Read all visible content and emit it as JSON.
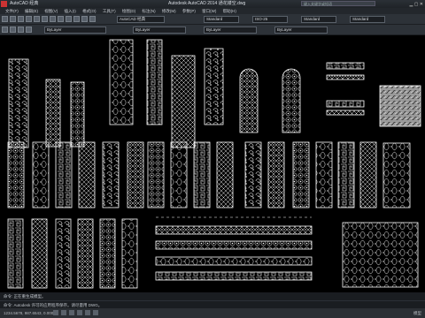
{
  "titlebar": {
    "workspace": "AutoCAD 经典",
    "title": "Autodesk AutoCAD 2014    通花镂空.dwg",
    "search_placeholder": "键入关键字或短语"
  },
  "menubar": [
    "文件(F)",
    "编辑(E)",
    "视图(V)",
    "插入(I)",
    "格式(O)",
    "工具(T)",
    "绘图(D)",
    "标注(N)",
    "修改(M)",
    "参数(P)",
    "窗口(W)",
    "帮助(H)"
  ],
  "toolbar1": {
    "workspace_select": "AutoCAD 经典",
    "text_style": "Standard",
    "dim_style": "ISO-25",
    "table_style": "Standard",
    "mleader_style": "Standard"
  },
  "toolbar2": {
    "layer": "ByLayer",
    "color": "ByLayer",
    "linetype": "ByLayer",
    "lineweight": "ByLayer"
  },
  "command": {
    "line1": "命令: 正在重生成模型。",
    "line2": "命令: Autodesk  许可的应用程序保存。请尽量用  DWG。"
  },
  "statusbar": {
    "coords": "1234.5678, 987.6543, 0.0000",
    "model": "模型"
  },
  "colors": {
    "background": "#000000",
    "pattern": "#ffffff",
    "accent": "#c33333"
  }
}
